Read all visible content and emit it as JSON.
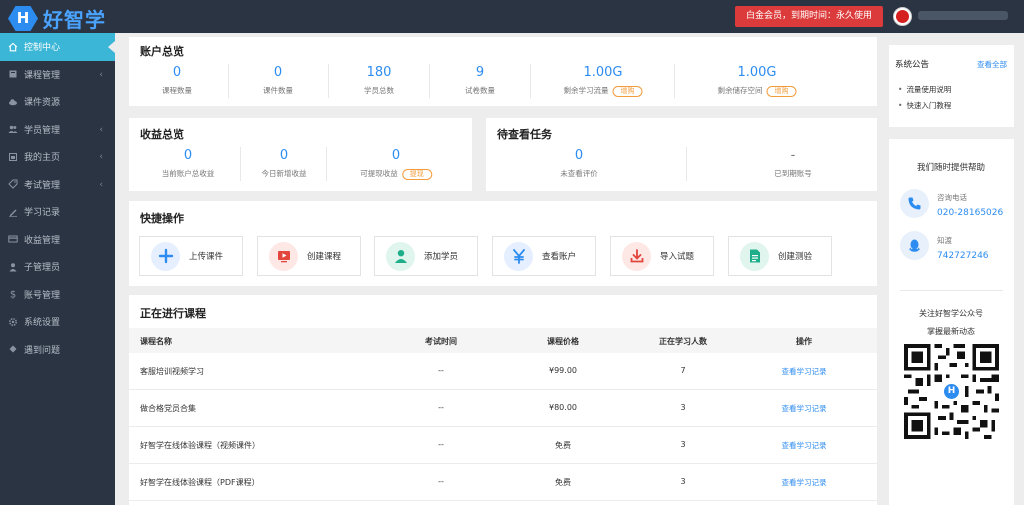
{
  "app": {
    "brand_letter": "H",
    "brand": "好智学"
  },
  "header": {
    "vip_text": "白金会员，到期时间：永久使用"
  },
  "sidebar": {
    "items": [
      {
        "label": "控制中心",
        "icon": "home-icon",
        "active": true,
        "arrow": false
      },
      {
        "label": "课程管理",
        "icon": "book-icon",
        "arrow": true
      },
      {
        "label": "课件资源",
        "icon": "cloud-icon",
        "arrow": false
      },
      {
        "label": "学员管理",
        "icon": "users-icon",
        "arrow": true
      },
      {
        "label": "我的主页",
        "icon": "homepage-icon",
        "arrow": true
      },
      {
        "label": "考试管理",
        "icon": "tag-icon",
        "arrow": true
      },
      {
        "label": "学习记录",
        "icon": "record-icon",
        "arrow": false
      },
      {
        "label": "收益管理",
        "icon": "card-icon",
        "arrow": false
      },
      {
        "label": "子管理员",
        "icon": "user-icon",
        "arrow": false
      },
      {
        "label": "账号管理",
        "icon": "dollar-icon",
        "arrow": false
      },
      {
        "label": "系统设置",
        "icon": "gear-icon",
        "arrow": false
      },
      {
        "label": "遇到问题",
        "icon": "help-icon",
        "arrow": false
      }
    ]
  },
  "account_overview": {
    "title": "账户总览",
    "stats": [
      {
        "value": "0",
        "label": "课程数量"
      },
      {
        "value": "0",
        "label": "课件数量"
      },
      {
        "value": "180",
        "label": "学员总数"
      },
      {
        "value": "9",
        "label": "试卷数量"
      },
      {
        "value": "1.00G",
        "label": "剩余学习流量",
        "action": "增购"
      },
      {
        "value": "1.00G",
        "label": "剩余储存空间",
        "action": "增购"
      }
    ]
  },
  "revenue_overview": {
    "title": "收益总览",
    "stats": [
      {
        "value": "0",
        "label": "当前账户总收益"
      },
      {
        "value": "0",
        "label": "今日新增收益"
      },
      {
        "value": "0",
        "label": "可提现收益",
        "action": "提现"
      }
    ]
  },
  "pending_tasks": {
    "title": "待查看任务",
    "stats": [
      {
        "value": "0",
        "label": "未查看评价"
      },
      {
        "value": "-",
        "label": "已到期账号"
      }
    ]
  },
  "quick_actions": {
    "title": "快捷操作",
    "items": [
      {
        "label": "上传课件",
        "icon": "plus-icon",
        "color": "#2d8cf0",
        "bg": "#e5efff"
      },
      {
        "label": "创建课程",
        "icon": "video-icon",
        "color": "#e2463c",
        "bg": "#fde8e6"
      },
      {
        "label": "添加学员",
        "icon": "person-icon",
        "color": "#1fae8a",
        "bg": "#e0f5ee"
      },
      {
        "label": "查看账户",
        "icon": "yen-icon",
        "color": "#2d8cf0",
        "bg": "#e5efff"
      },
      {
        "label": "导入试题",
        "icon": "download-icon",
        "color": "#e2463c",
        "bg": "#fde8e6"
      },
      {
        "label": "创建测验",
        "icon": "document-icon",
        "color": "#1fae8a",
        "bg": "#e0f5ee"
      }
    ]
  },
  "courses": {
    "title": "正在进行课程",
    "columns": [
      "课程名称",
      "考试时间",
      "课程价格",
      "正在学习人数",
      "操作"
    ],
    "rows": [
      {
        "name": "客服培训视频学习",
        "exam_time": "--",
        "price": "¥99.00",
        "learners": "7",
        "action": "查看学习记录"
      },
      {
        "name": "做合格党员合集",
        "exam_time": "--",
        "price": "¥80.00",
        "learners": "3",
        "action": "查看学习记录"
      },
      {
        "name": "好智学在线体验课程（视频课件）",
        "exam_time": "--",
        "price": "免费",
        "learners": "3",
        "action": "查看学习记录"
      },
      {
        "name": "好智学在线体验课程（PDF课程）",
        "exam_time": "--",
        "price": "免费",
        "learners": "3",
        "action": "查看学习记录"
      }
    ]
  },
  "notice": {
    "title": "系统公告",
    "view_all": "查看全部",
    "items": [
      "流量使用说明",
      "快速入门教程"
    ]
  },
  "help": {
    "title": "我们随时提供帮助",
    "phone_label": "咨询电话",
    "phone": "020-28165026",
    "qq_label": "知渡",
    "qq": "742727246"
  },
  "wechat": {
    "line1": "关注好智学公众号",
    "line2": "掌握最新动态",
    "qr_letter": "H"
  }
}
